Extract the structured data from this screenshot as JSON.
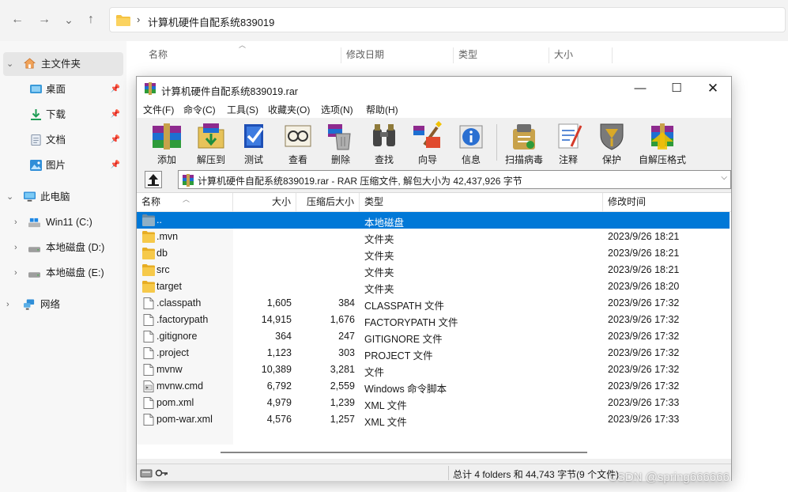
{
  "explorer": {
    "nav": {
      "back": "←",
      "forward": "→",
      "recent": "⌄",
      "up": "↑"
    },
    "address": {
      "chevron": "›",
      "path": "计算机硬件自配系统839019"
    },
    "columns": {
      "name": "名称",
      "modified": "修改日期",
      "type": "类型",
      "size": "大小"
    },
    "sidebar": {
      "home": "主文件夹",
      "quick": [
        {
          "label": "桌面",
          "icon": "desktop-icon"
        },
        {
          "label": "下载",
          "icon": "download-icon"
        },
        {
          "label": "文档",
          "icon": "document-icon"
        },
        {
          "label": "图片",
          "icon": "picture-icon"
        }
      ],
      "pc": "此电脑",
      "drives": [
        {
          "label": "Win11 (C:)"
        },
        {
          "label": "本地磁盘 (D:)"
        },
        {
          "label": "本地磁盘 (E:)"
        }
      ],
      "network": "网络"
    }
  },
  "rar": {
    "title": "计算机硬件自配系统839019.rar",
    "menu": [
      "文件(F)",
      "命令(C)",
      "工具(S)",
      "收藏夹(O)",
      "选项(N)",
      "帮助(H)"
    ],
    "toolbar": [
      {
        "label": "添加",
        "icon": "add-archive-icon"
      },
      {
        "label": "解压到",
        "icon": "extract-to-icon"
      },
      {
        "label": "测试",
        "icon": "test-icon"
      },
      {
        "label": "查看",
        "icon": "view-icon"
      },
      {
        "label": "删除",
        "icon": "delete-icon"
      },
      {
        "label": "查找",
        "icon": "find-icon"
      },
      {
        "label": "向导",
        "icon": "wizard-icon"
      },
      {
        "label": "信息",
        "icon": "info-icon"
      },
      {
        "label": "扫描病毒",
        "icon": "scan-virus-icon"
      },
      {
        "label": "注释",
        "icon": "comment-icon"
      },
      {
        "label": "保护",
        "icon": "protect-icon"
      },
      {
        "label": "自解压格式",
        "icon": "sfx-icon"
      }
    ],
    "path_text": "计算机硬件自配系统839019.rar - RAR 压缩文件, 解包大小为 42,437,926 字节",
    "headers": {
      "name": "名称",
      "size": "大小",
      "packed": "压缩后大小",
      "type": "类型",
      "modified": "修改时间"
    },
    "files": [
      {
        "name": "..",
        "size": "",
        "packed": "",
        "type": "本地磁盘",
        "modified": "",
        "kind": "folder"
      },
      {
        "name": ".mvn",
        "size": "",
        "packed": "",
        "type": "文件夹",
        "modified": "2023/9/26 18:21",
        "kind": "folder"
      },
      {
        "name": "db",
        "size": "",
        "packed": "",
        "type": "文件夹",
        "modified": "2023/9/26 18:21",
        "kind": "folder"
      },
      {
        "name": "src",
        "size": "",
        "packed": "",
        "type": "文件夹",
        "modified": "2023/9/26 18:21",
        "kind": "folder"
      },
      {
        "name": "target",
        "size": "",
        "packed": "",
        "type": "文件夹",
        "modified": "2023/9/26 18:20",
        "kind": "folder"
      },
      {
        "name": ".classpath",
        "size": "1,605",
        "packed": "384",
        "type": "CLASSPATH 文件",
        "modified": "2023/9/26 17:32",
        "kind": "file"
      },
      {
        "name": ".factorypath",
        "size": "14,915",
        "packed": "1,676",
        "type": "FACTORYPATH 文件",
        "modified": "2023/9/26 17:32",
        "kind": "file"
      },
      {
        "name": ".gitignore",
        "size": "364",
        "packed": "247",
        "type": "GITIGNORE 文件",
        "modified": "2023/9/26 17:32",
        "kind": "file"
      },
      {
        "name": ".project",
        "size": "1,123",
        "packed": "303",
        "type": "PROJECT 文件",
        "modified": "2023/9/26 17:32",
        "kind": "file"
      },
      {
        "name": "mvnw",
        "size": "10,389",
        "packed": "3,281",
        "type": "文件",
        "modified": "2023/9/26 17:32",
        "kind": "file"
      },
      {
        "name": "mvnw.cmd",
        "size": "6,792",
        "packed": "2,559",
        "type": "Windows 命令脚本",
        "modified": "2023/9/26 17:32",
        "kind": "cmd"
      },
      {
        "name": "pom.xml",
        "size": "4,979",
        "packed": "1,239",
        "type": "XML 文件",
        "modified": "2023/9/26 17:33",
        "kind": "file"
      },
      {
        "name": "pom-war.xml",
        "size": "4,576",
        "packed": "1,257",
        "type": "XML 文件",
        "modified": "2023/9/26 17:33",
        "kind": "file"
      }
    ],
    "status": "总计 4 folders 和 44,743 字节(9 个文件)"
  },
  "watermark": "CSDN @spring666666",
  "colors": {
    "selection": "#0078d7",
    "folder": "#f5c342",
    "window_bg": "#f0f0f0"
  }
}
